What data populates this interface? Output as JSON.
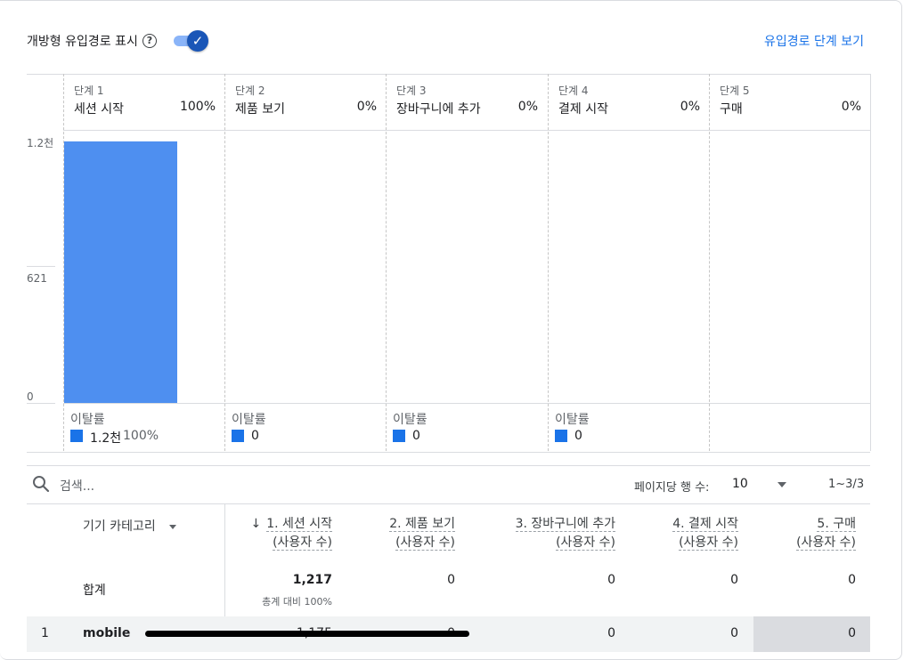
{
  "header": {
    "toggle_label": "개방형 유입경로 표시",
    "toggle_on": true,
    "help_icon": "help-circle-icon",
    "link": "유입경로 단계 보기"
  },
  "chart_data": {
    "type": "bar",
    "categories": [
      "세션 시작",
      "제품 보기",
      "장바구니에 추가",
      "결제 시작",
      "구매"
    ],
    "step_labels": [
      "단계 1",
      "단계 2",
      "단계 3",
      "단계 4",
      "단계 5"
    ],
    "percents": [
      "100%",
      "0%",
      "0%",
      "0%",
      "0%"
    ],
    "values": [
      1217,
      0,
      0,
      0,
      0
    ],
    "yticks": [
      "1.2천",
      "621",
      "0"
    ],
    "ylim": [
      0,
      1242
    ],
    "bar_color": "#4e8ff0",
    "dropoff": {
      "label": "이탈률",
      "values": [
        "1.2천",
        "0",
        "0",
        "0"
      ],
      "pct": "100%",
      "swatch_color": "#1a73e8"
    }
  },
  "table": {
    "search_placeholder": "검색...",
    "rows_per_page_label": "페이지당 행 수:",
    "rows_per_page": "10",
    "range": "1~3/3",
    "dimension_header": "기기 카테고리",
    "sort_icon": "arrow-down-icon",
    "columns": [
      {
        "title": "1. 세션 시작",
        "sub": "(사용자 수)"
      },
      {
        "title": "2. 제품 보기",
        "sub": "(사용자 수)"
      },
      {
        "title": "3. 장바구니에 추가",
        "sub": "(사용자 수)"
      },
      {
        "title": "4. 결제 시작",
        "sub": "(사용자 수)"
      },
      {
        "title": "5. 구매",
        "sub": "(사용자 수)"
      }
    ],
    "total_label": "합계",
    "totals": [
      "1,217",
      "0",
      "0",
      "0",
      "0"
    ],
    "total_sub": "총계 대비 100%",
    "rows": [
      {
        "index": "1",
        "name": "mobile",
        "values": [
          "1,175",
          "0",
          "0",
          "0",
          "0"
        ]
      }
    ]
  }
}
